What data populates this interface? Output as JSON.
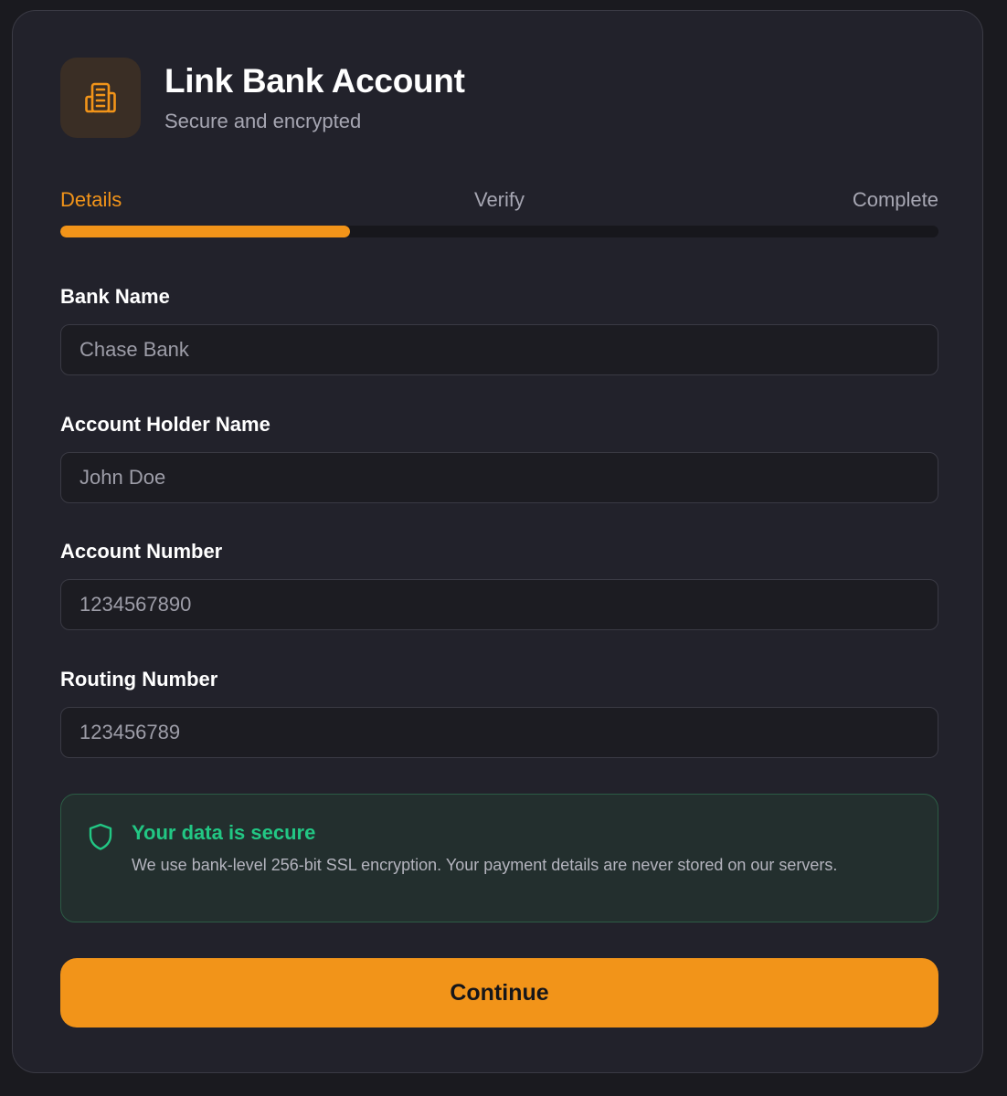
{
  "header": {
    "icon": "bank-building-icon",
    "title": "Link Bank Account",
    "subtitle": "Secure and encrypted"
  },
  "steps": {
    "items": [
      {
        "label": "Details",
        "active": true
      },
      {
        "label": "Verify",
        "active": false
      },
      {
        "label": "Complete",
        "active": false
      }
    ],
    "progress_fraction": 0.33
  },
  "form": {
    "bank_name": {
      "label": "Bank Name",
      "placeholder": "Chase Bank"
    },
    "holder_name": {
      "label": "Account Holder Name",
      "placeholder": "John Doe"
    },
    "account_number": {
      "label": "Account Number",
      "placeholder": "1234567890"
    },
    "routing_number": {
      "label": "Routing Number",
      "placeholder": "123456789"
    }
  },
  "security": {
    "icon": "shield-icon",
    "title": "Your data is secure",
    "text": "We use bank-level 256-bit SSL encryption. Your payment details are never stored on our servers."
  },
  "actions": {
    "continue_label": "Continue"
  },
  "colors": {
    "accent": "#f29419",
    "success": "#22c784",
    "card_bg": "#22222b",
    "page_bg": "#1a1a1f"
  }
}
